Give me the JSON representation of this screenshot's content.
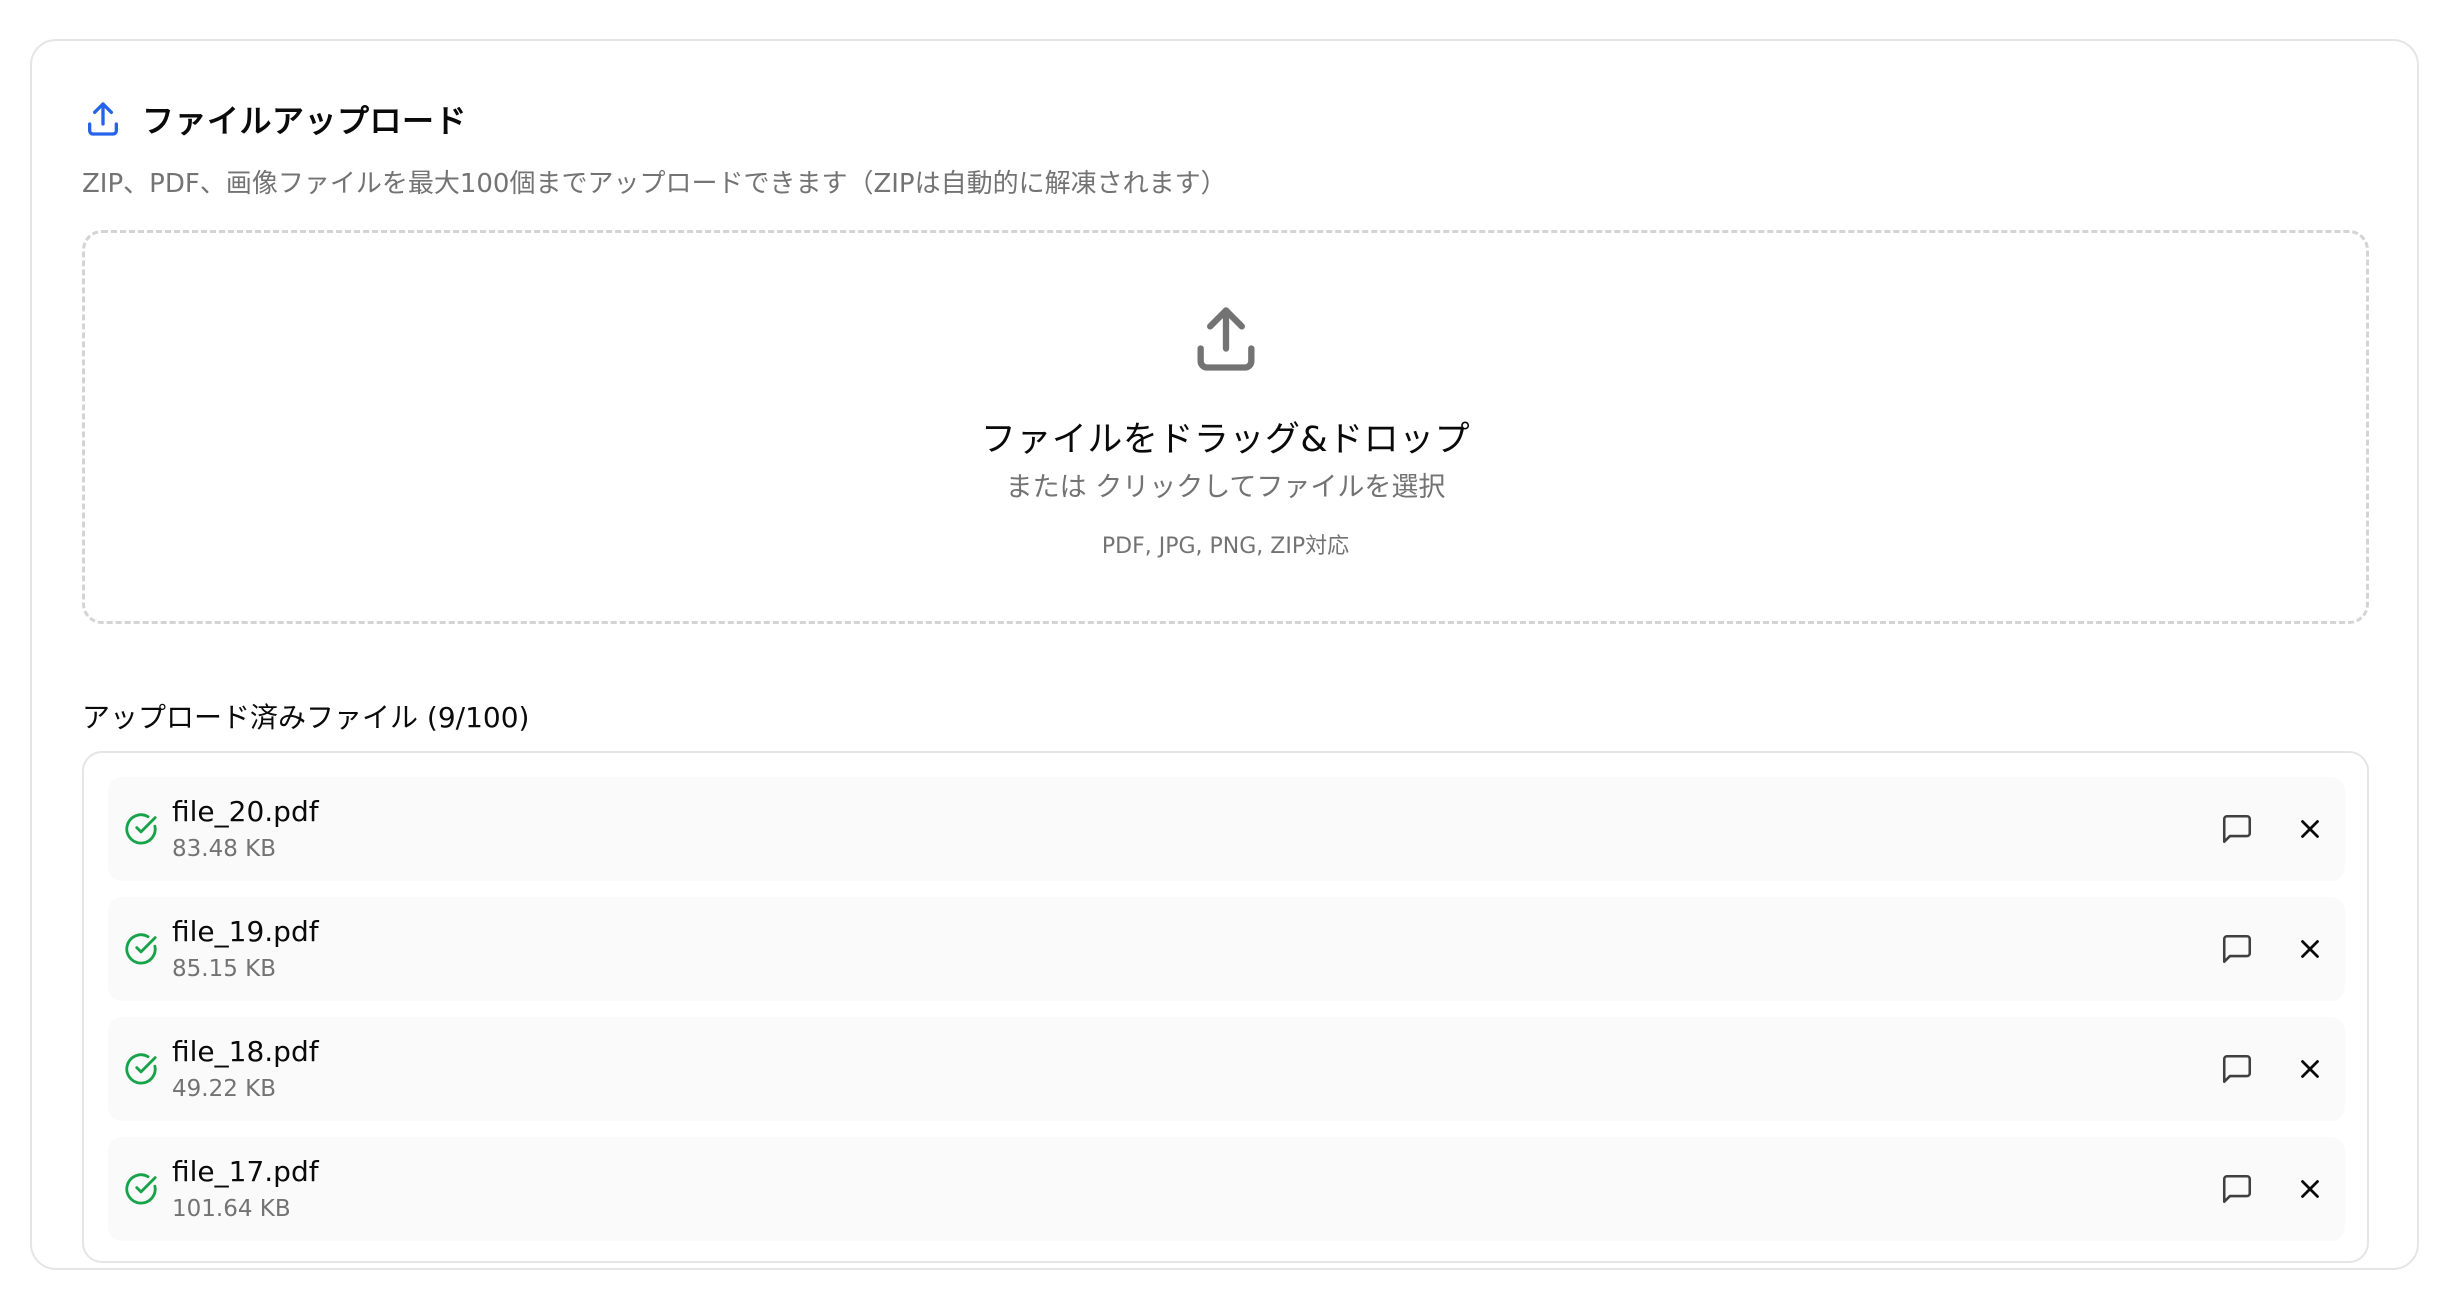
{
  "header": {
    "title": "ファイルアップロード",
    "subtitle": "ZIP、PDF、画像ファイルを最大100個までアップロードできます（ZIPは自動的に解凍されます）",
    "icon": "upload-icon",
    "icon_color": "#2563eb"
  },
  "dropzone": {
    "icon": "upload-icon",
    "title": "ファイルをドラッグ&ドロップ",
    "subtitle": "または クリックしてファイルを選択",
    "formats": "PDF, JPG, PNG, ZIP対応"
  },
  "uploaded": {
    "heading": "アップロード済みファイル (9/100)",
    "files": [
      {
        "name": "file_20.pdf",
        "size": "83.48 KB",
        "status": "complete"
      },
      {
        "name": "file_19.pdf",
        "size": "85.15 KB",
        "status": "complete"
      },
      {
        "name": "file_18.pdf",
        "size": "49.22 KB",
        "status": "complete"
      },
      {
        "name": "file_17.pdf",
        "size": "101.64 KB",
        "status": "complete"
      }
    ]
  },
  "colors": {
    "success": "#16a34a",
    "accent": "#2563eb",
    "muted": "#737373"
  }
}
